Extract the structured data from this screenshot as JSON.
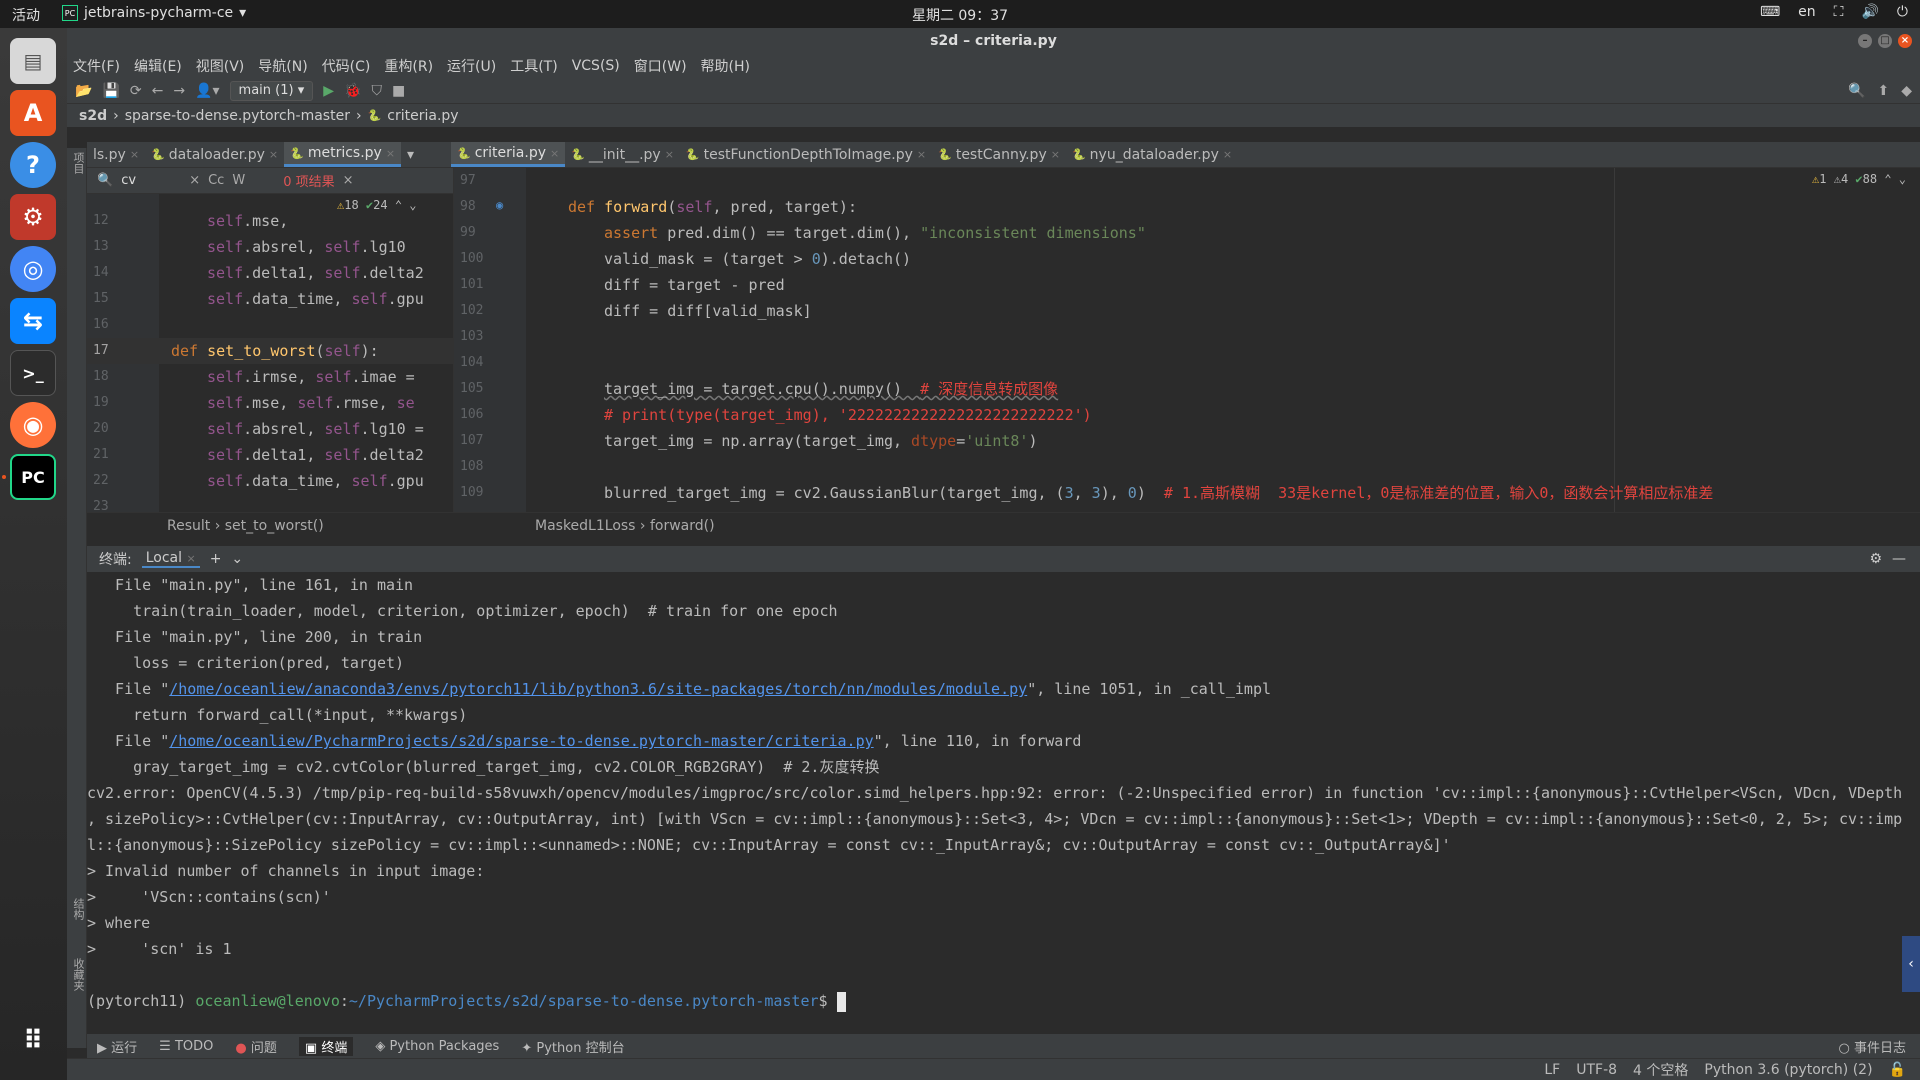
{
  "topbar": {
    "activities": "活动",
    "app_name": "jetbrains-pycharm-ce",
    "clock": "星期二 09：37",
    "lang": "en"
  },
  "window": {
    "title": "s2d – criteria.py"
  },
  "menu": [
    "文件(F)",
    "编辑(E)",
    "视图(V)",
    "导航(N)",
    "代码(C)",
    "重构(R)",
    "运行(U)",
    "工具(T)",
    "VCS(S)",
    "窗口(W)",
    "帮助(H)"
  ],
  "toolbar": {
    "run_config": "main (1)"
  },
  "breadcrumb": [
    "s2d",
    "sparse-to-dense.pytorch-master",
    "criteria.py"
  ],
  "left_tabs": [
    {
      "label": "ls.py"
    },
    {
      "label": "dataloader.py"
    },
    {
      "label": "metrics.py"
    }
  ],
  "right_tabs": [
    {
      "label": "criteria.py"
    },
    {
      "label": "__init__.py"
    },
    {
      "label": "testFunctionDepthToImage.py"
    },
    {
      "label": "testCanny.py"
    },
    {
      "label": "nyu_dataloader.py"
    }
  ],
  "find": {
    "query": "cv",
    "result": "0 项结果",
    "opt1": "Cc",
    "opt2": "W"
  },
  "left_inspection": {
    "warnings": "18",
    "ok": "24"
  },
  "right_inspection": {
    "err": "1",
    "warn": "4",
    "ok": "88"
  },
  "left_lines": [
    "12",
    "13",
    "14",
    "15",
    "16",
    "17",
    "18",
    "19",
    "20",
    "21",
    "22",
    "23"
  ],
  "right_lines": [
    "97",
    "98",
    "99",
    "100",
    "101",
    "102",
    "103",
    "104",
    "105",
    "106",
    "107",
    "108",
    "109"
  ],
  "left_crumbs": [
    "Result",
    "set_to_worst()"
  ],
  "right_crumbs": [
    "MaskedL1Loss",
    "forward()"
  ],
  "terminal": {
    "label": "终端:",
    "tab": "Local",
    "l1": "  File \"main.py\", line 161, in main",
    "l2": "    train(train_loader, model, criterion, optimizer, epoch)  # train for one epoch",
    "l3": "  File \"main.py\", line 200, in train",
    "l4": "    loss = criterion(pred, target)",
    "l5_pre": "  File \"",
    "l5_link": "/home/oceanliew/anaconda3/envs/pytorch11/lib/python3.6/site-packages/torch/nn/modules/module.py",
    "l5_post": "\", line 1051, in _call_impl",
    "l6": "    return forward_call(*input, **kwargs)",
    "l7_pre": "  File \"",
    "l7_link": "/home/oceanliew/PycharmProjects/s2d/sparse-to-dense.pytorch-master/criteria.py",
    "l7_post": "\", line 110, in forward",
    "l8": "    gray_target_img = cv2.cvtColor(blurred_target_img, cv2.COLOR_RGB2GRAY)  # 2.灰度转换",
    "l9": "cv2.error: OpenCV(4.5.3) /tmp/pip-req-build-s58vuwxh/opencv/modules/imgproc/src/color.simd_helpers.hpp:92: error: (-2:Unspecified error) in function 'cv::impl::{anonymous}::CvtHelper<VScn, VDcn, VDepth",
    "l10": ", sizePolicy>::CvtHelper(cv::InputArray, cv::OutputArray, int) [with VScn = cv::impl::{anonymous}::Set<3, 4>; VDcn = cv::impl::{anonymous}::Set<1>; VDepth = cv::impl::{anonymous}::Set<0, 2, 5>; cv::imp",
    "l11": "l::{anonymous}::SizePolicy sizePolicy = cv::impl::<unnamed>::NONE; cv::InputArray = const cv::_InputArray&; cv::OutputArray = const cv::_OutputArray&]'",
    "l12": "> Invalid number of channels in input image:",
    "l13": ">     'VScn::contains(scn)'",
    "l14": "> where",
    "l15": ">     'scn' is 1",
    "prompt_env": "(pytorch11) ",
    "prompt_user": "oceanliew@lenovo",
    "prompt_sep": ":",
    "prompt_path": "~/PycharmProjects/s2d/sparse-to-dense.pytorch-master",
    "prompt_end": "$ "
  },
  "bottom_tools": [
    "运行",
    "TODO",
    "问题",
    "终端",
    "Python Packages",
    "Python 控制台"
  ],
  "event_log": "事件日志",
  "side_labels": {
    "project": "项目",
    "structure": "结构",
    "favorites": "收藏夹"
  },
  "status": {
    "lf": "LF",
    "encoding": "UTF-8",
    "indent": "4 个空格",
    "interpreter": "Python 3.6 (pytorch) (2)"
  }
}
